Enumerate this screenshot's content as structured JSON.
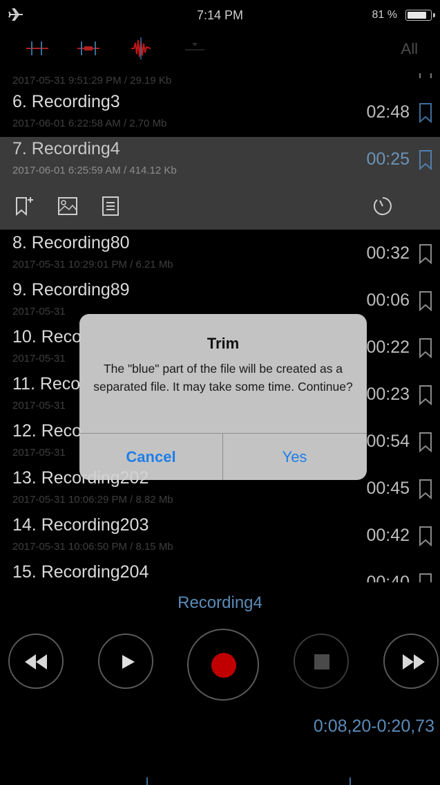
{
  "status_bar": {
    "time": "7:14 PM",
    "battery_percent": "81 %"
  },
  "toolbar": {
    "filter_label": "All"
  },
  "recordings": [
    {
      "title": "",
      "meta": "2017-05-31 9:51:29 PM / 29.19 Kb",
      "duration": ""
    },
    {
      "title": "6. Recording3",
      "meta": "2017-06-01 6:22:58 AM / 2.70 Mb",
      "duration": "02:48"
    },
    {
      "title": "7. Recording4",
      "meta": "2017-06-01 6:25:59 AM / 414.12 Kb",
      "duration": "00:25",
      "selected": true
    },
    {
      "title": "8. Recording80",
      "meta": "2017-05-31 10:29:01 PM / 6.21 Mb",
      "duration": "00:32"
    },
    {
      "title": "9. Recording89",
      "meta": "2017-05-31",
      "duration": "00:06"
    },
    {
      "title": "10. Reco",
      "meta": "2017-05-31",
      "duration": "00:22"
    },
    {
      "title": "11. Reco",
      "meta": "2017-05-31",
      "duration": "00:23"
    },
    {
      "title": "12. Reco",
      "meta": "2017-05-31",
      "duration": "00:54"
    },
    {
      "title": "13. Recording202",
      "meta": "2017-05-31 10:06:29 PM / 8.82 Mb",
      "duration": "00:45"
    },
    {
      "title": "14. Recording203",
      "meta": "2017-05-31 10:06:50 PM / 8.15 Mb",
      "duration": "00:42"
    },
    {
      "title": "15. Recording204",
      "meta": "",
      "duration": "00:40"
    }
  ],
  "dialog": {
    "title": "Trim",
    "message": "The \"blue\" part of the file will be created as a separated file. It may take some time. Continue?",
    "cancel_label": "Cancel",
    "yes_label": "Yes"
  },
  "player": {
    "now_playing": "Recording4",
    "range": "0:08,20-0:20,73"
  },
  "colors": {
    "accent": "#5b8bb8",
    "record": "#c00000",
    "dialog_button": "#1f7ee8"
  }
}
